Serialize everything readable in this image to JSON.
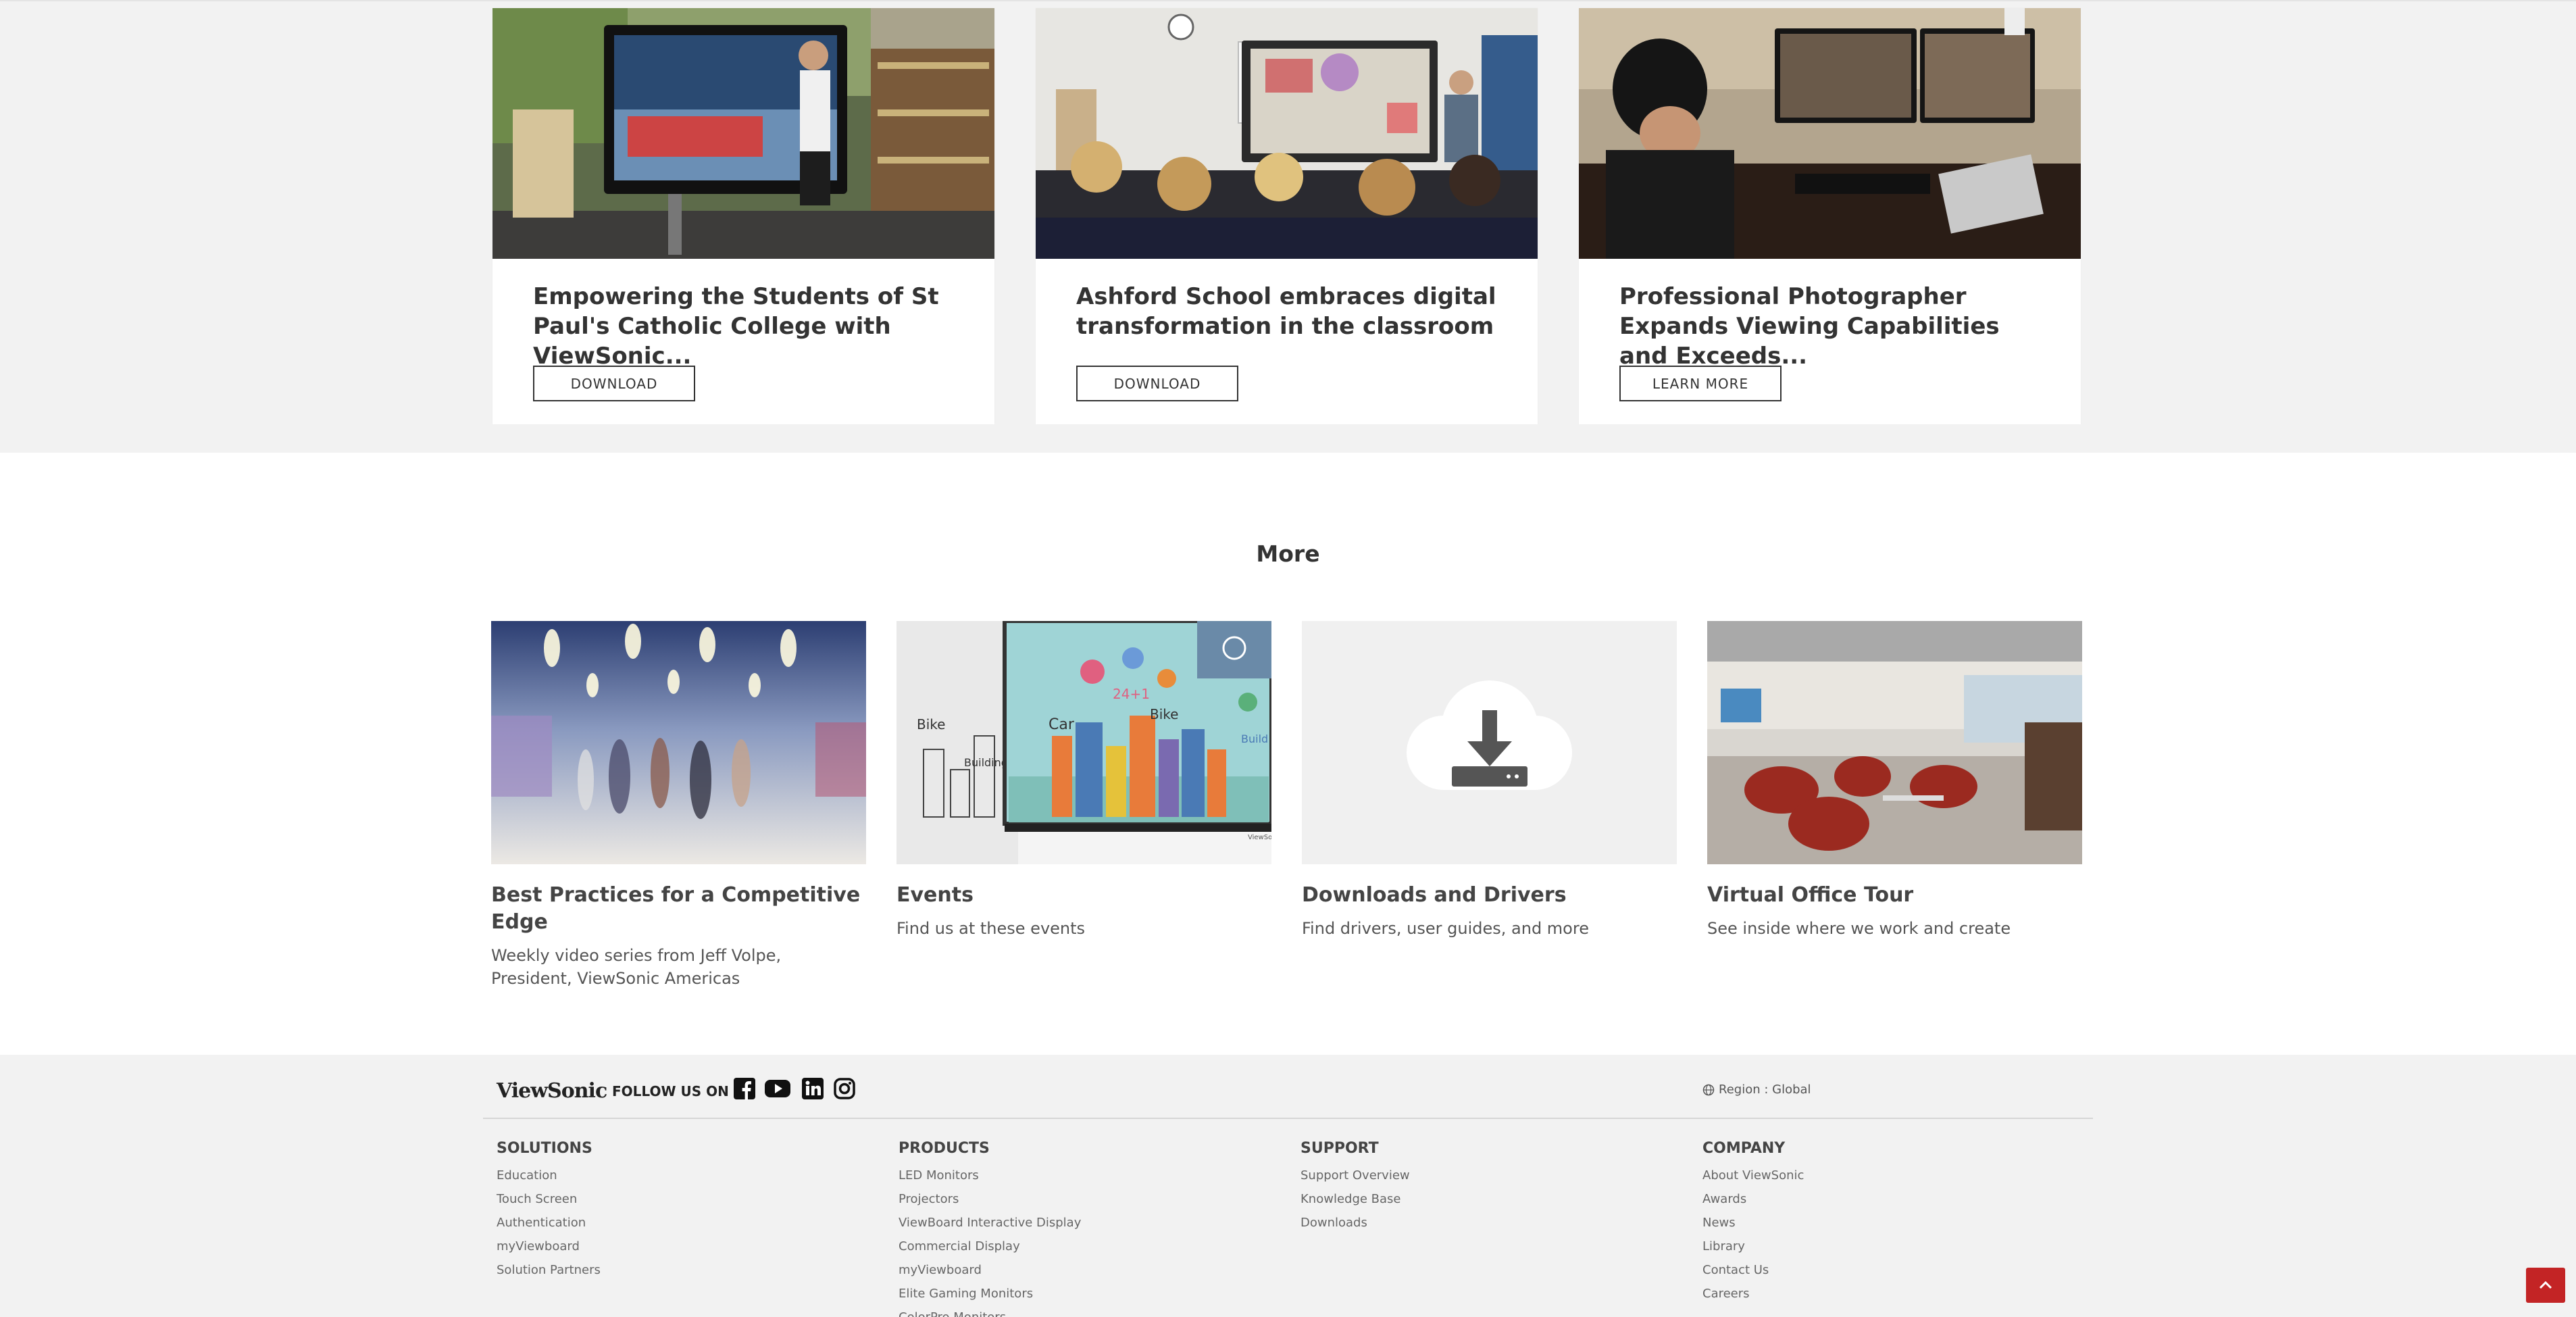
{
  "case_studies": [
    {
      "title": "Empowering the Students of St Paul's Catholic College with ViewSonic...",
      "button": "DOWNLOAD"
    },
    {
      "title": "Ashford School embraces digital transformation in the classroom",
      "button": "DOWNLOAD"
    },
    {
      "title": "Professional Photographer Expands Viewing Capabilities and Exceeds...",
      "button": "LEARN MORE"
    }
  ],
  "more": {
    "heading": "More",
    "items": [
      {
        "name": "Best Practices for a Competitive Edge",
        "desc": "Weekly video series from Jeff Volpe, President, ViewSonic Americas"
      },
      {
        "name": "Events",
        "desc": "Find us at these events"
      },
      {
        "name": "Downloads and Drivers",
        "desc": "Find drivers, user guides, and more"
      },
      {
        "name": "Virtual Office Tour",
        "desc": "See inside where we work and create"
      }
    ]
  },
  "events_image_text": {
    "bike": "Bike",
    "building": "Building",
    "car": "Car",
    "bike2": "Bike",
    "build": "Build",
    "date": "24+1",
    "brand": "ViewSonic"
  },
  "footer": {
    "logo": "ViewSonic",
    "follow_label": "FOLLOW US ON",
    "social_icons": [
      "facebook-icon",
      "youtube-icon",
      "linkedin-icon",
      "instagram-icon"
    ],
    "region": "Region : Global",
    "columns": [
      {
        "heading": "SOLUTIONS",
        "links": [
          "Education",
          "Touch Screen",
          "Authentication",
          "myViewboard",
          "Solution Partners"
        ]
      },
      {
        "heading": "PRODUCTS",
        "links": [
          "LED Monitors",
          "Projectors",
          "ViewBoard Interactive Display",
          "Commercial Display",
          "myViewboard",
          "Elite Gaming Monitors",
          "ColorPro Monitors"
        ]
      },
      {
        "heading": "SUPPORT",
        "links": [
          "Support Overview",
          "Knowledge Base",
          "Downloads"
        ]
      },
      {
        "heading": "COMPANY",
        "links": [
          "About ViewSonic",
          "Awards",
          "News",
          "Library",
          "Contact Us",
          "Careers"
        ]
      }
    ]
  },
  "colors": {
    "accent": "#c32425",
    "section_bg": "#f2f2f2",
    "text": "#333333"
  }
}
